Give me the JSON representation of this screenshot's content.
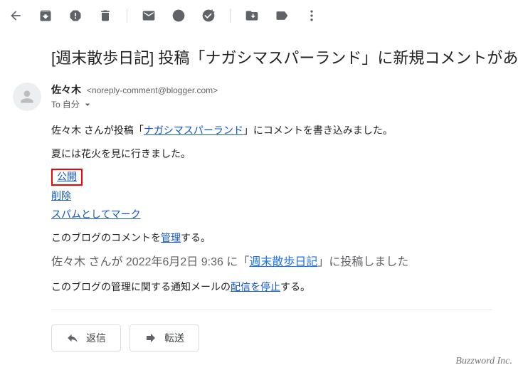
{
  "subject": "[週末散歩日記] 投稿「ナガシマスパーランド」に新規コメントがあ",
  "sender": {
    "name": "佐々木",
    "email": "<noreply-comment@blogger.com>"
  },
  "to": {
    "prefix": "To",
    "value": "自分"
  },
  "body": {
    "line1_a": "佐々木 さんが投稿「",
    "line1_link": "ナガシマスパーランド",
    "line1_b": "」にコメントを書き込みました。",
    "line2": "夏には花火を見に行きました。",
    "actions": {
      "publish": "公開",
      "delete": "削除",
      "spam": "スパムとしてマーク"
    },
    "manage_a": "このブログのコメントを",
    "manage_link": "管理",
    "manage_b": "する。",
    "meta_a": "佐々木 さんが 2022年6月2日 9:36 に「",
    "meta_link": "週末散歩日記",
    "meta_b": "」に投稿しました",
    "stop_a": "このブログの管理に関する通知メールの",
    "stop_link": "配信を停止",
    "stop_b": "する。"
  },
  "buttons": {
    "reply": "返信",
    "forward": "転送"
  },
  "watermark": "Buzzword Inc."
}
